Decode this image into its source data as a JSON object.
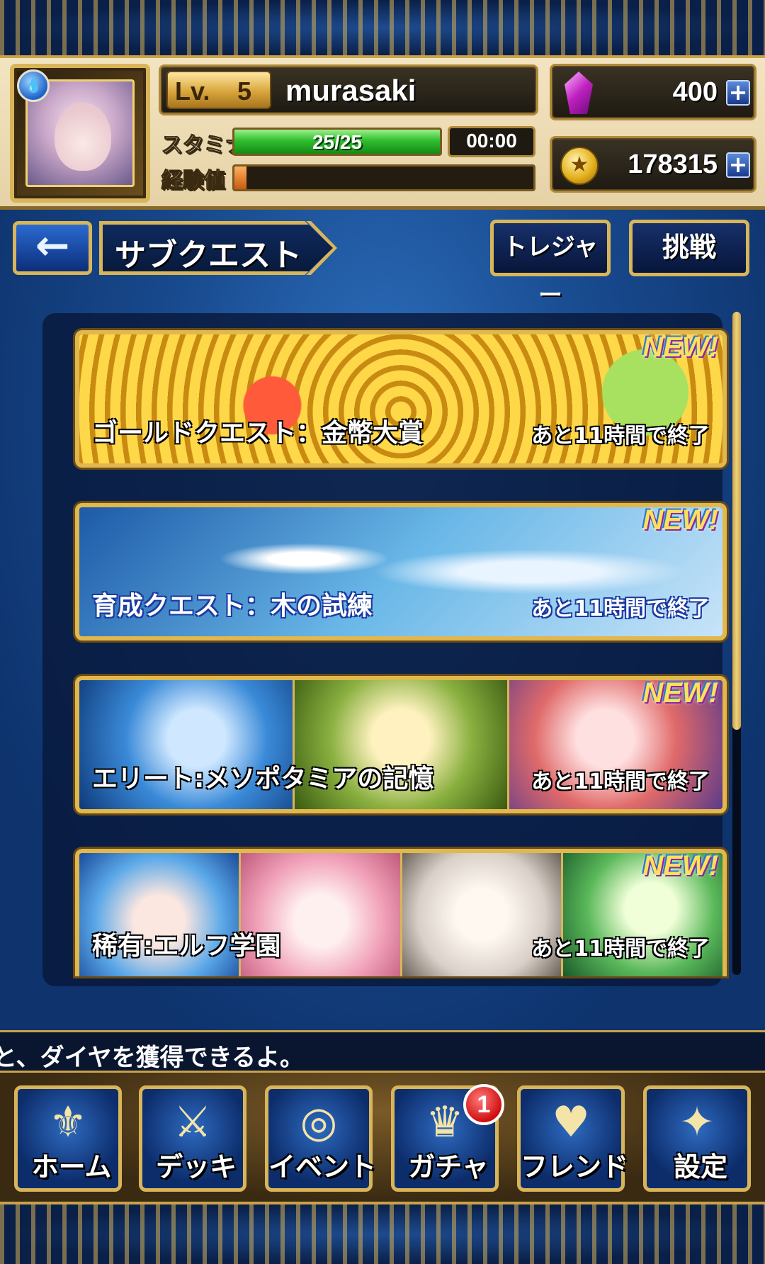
{
  "player": {
    "level_label": "Lv.",
    "level": "5",
    "name": "murasaki",
    "element_icon": "water-drop-icon",
    "stamina_label": "スタミナ",
    "stamina_text": "25/25",
    "stamina_fraction": 1.0,
    "stamina_timer": "00:00",
    "exp_label": "経験値",
    "exp_fraction": 0.04
  },
  "currency": {
    "diamonds": "400",
    "coins": "178315",
    "plus_label": "+"
  },
  "page": {
    "back_icon": "←",
    "title": "サブクエスト",
    "treasure_label": "トレジャー",
    "challenge_label": "挑戦"
  },
  "quests": [
    {
      "title": "ゴールドクエスト：金幣大賞",
      "time": "あと11時間で終了",
      "badge": "NEW!"
    },
    {
      "title": "育成クエスト：木の試練",
      "time": "あと11時間で終了",
      "badge": "NEW!"
    },
    {
      "title": "エリート:メソポタミアの記憶",
      "time": "あと11時間で終了",
      "badge": "NEW!"
    },
    {
      "title": "稀有:エルフ学園",
      "time": "あと11時間で終了",
      "badge": "NEW!"
    }
  ],
  "ticker": "と、ダイヤを獲得できるよ。",
  "nav": [
    {
      "label": "ホーム",
      "icon": "home-crest-icon"
    },
    {
      "label": "デッキ",
      "icon": "deck-sword-icon"
    },
    {
      "label": "イベント",
      "icon": "event-portal-icon"
    },
    {
      "label": "ガチャ",
      "icon": "gacha-dragon-icon",
      "badge": "1"
    },
    {
      "label": "フレンド",
      "icon": "friend-wings-icon"
    },
    {
      "label": "設定",
      "icon": "settings-gem-icon"
    }
  ],
  "colors": {
    "gold_frame": "#d9b55a",
    "stamina_green": "#2fbf2f",
    "exp_orange": "#c85a10",
    "badge_red": "#d01010"
  }
}
